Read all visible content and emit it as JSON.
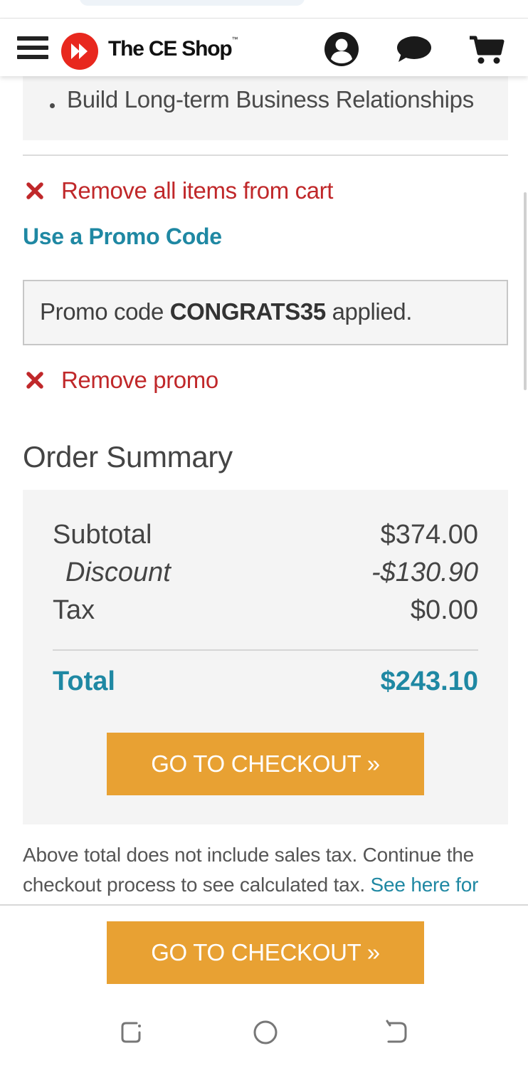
{
  "header": {
    "brand_name": "The CE Shop",
    "trademark": "™",
    "icons": [
      "menu-icon",
      "logo-play-icon",
      "account-icon",
      "chat-icon",
      "cart-icon"
    ]
  },
  "cart": {
    "bullet_item": "Build Long-term Business Relationships",
    "remove_all_label": "Remove all items from cart",
    "promo_link_label": "Use a Promo Code",
    "promo_message_prefix": "Promo code",
    "promo_code": "CONGRATS35",
    "promo_message_suffix": "applied.",
    "remove_promo_label": "Remove promo"
  },
  "order_summary": {
    "title": "Order Summary",
    "subtotal_label": "Subtotal",
    "subtotal_value": "$374.00",
    "discount_label": "Discount",
    "discount_value": "-$130.90",
    "tax_label": "Tax",
    "tax_value": "$0.00",
    "total_label": "Total",
    "total_value": "$243.10",
    "checkout_label": "GO TO CHECKOUT »"
  },
  "tax_note": {
    "text": "Above total does not include sales tax. Continue the checkout process to see calculated tax.",
    "link_label": "See here for"
  },
  "sticky": {
    "checkout_label": "GO TO CHECKOUT »"
  },
  "colors": {
    "accent_teal": "#1f88a3",
    "remove_red": "#c0282a",
    "checkout_orange": "#e8a133",
    "logo_red": "#e8281e"
  }
}
